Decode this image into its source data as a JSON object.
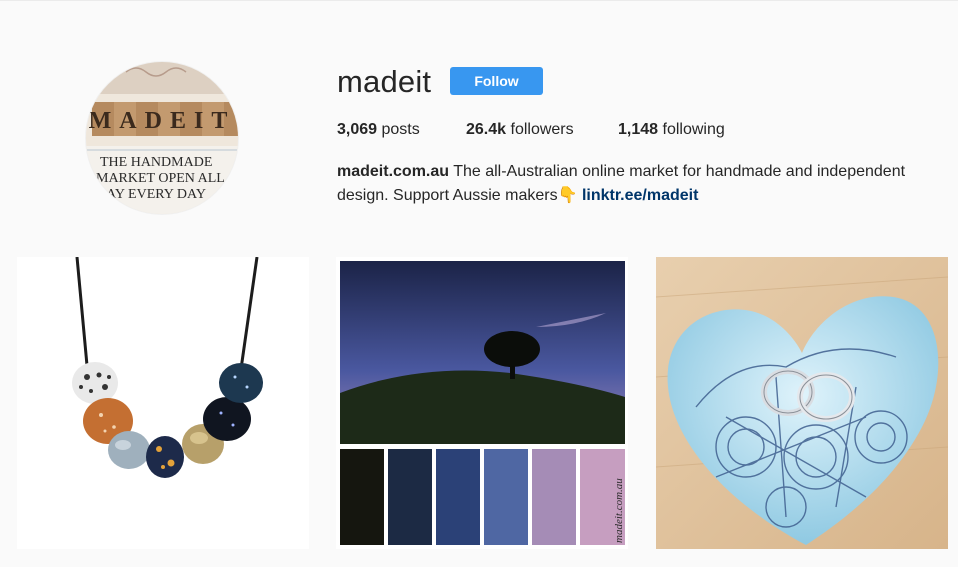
{
  "profile": {
    "username": "madeit",
    "follow_label": "Follow",
    "avatar_text_top": "MADEIT",
    "avatar_text_lines": [
      "THE HANDMADE",
      "MARKET OPEN ALL",
      "DAY EVERY DAY"
    ]
  },
  "stats": {
    "posts_count": "3,069",
    "posts_label": "posts",
    "followers_count": "26.4k",
    "followers_label": "followers",
    "following_count": "1,148",
    "following_label": "following"
  },
  "bio": {
    "name": "madeit.com.au",
    "text": " The all-Australian online market for handmade and independent design. Support Aussie makers",
    "emoji": "👇",
    "link": "linktr.ee/madeit"
  },
  "posts": [
    {
      "subject": "necklace-photo"
    },
    {
      "subject": "night-sky-palette",
      "watermark": "madeit.com.au",
      "palette": [
        "#15160f",
        "#1c2a44",
        "#2b4177",
        "#4f67a3",
        "#a58cb6",
        "#c69ec0"
      ]
    },
    {
      "subject": "heart-ring-dish"
    }
  ],
  "colors": {
    "follow_button": "#3897f0",
    "link": "#003569",
    "text": "#262626",
    "background": "#fafafa"
  }
}
